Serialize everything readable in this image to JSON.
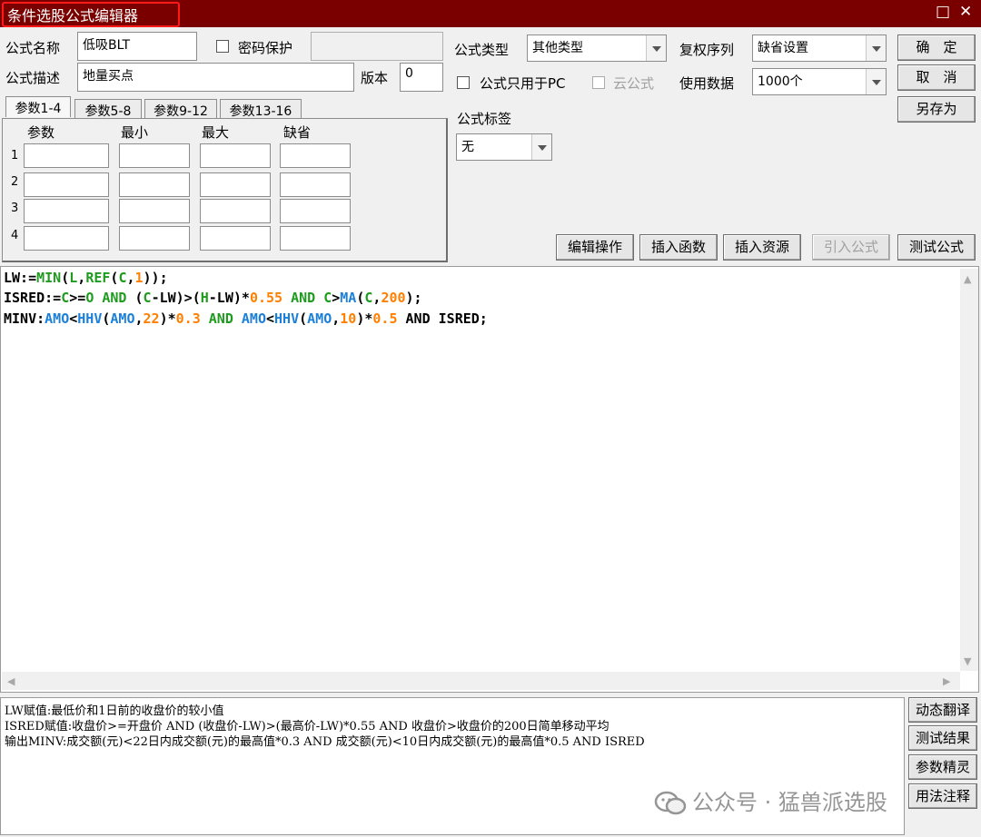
{
  "window": {
    "title": "条件选股公式编辑器",
    "maximize_icon": "□",
    "close_icon": "✕"
  },
  "form": {
    "name_label": "公式名称",
    "name_value": "低吸BLT",
    "password_label": "密码保护",
    "desc_label": "公式描述",
    "desc_value": "地量买点",
    "version_label": "版本",
    "version_value": "0",
    "type_label": "公式类型",
    "type_value": "其他类型",
    "restore_label": "复权序列",
    "restore_value": "缺省设置",
    "pc_only_label": "公式只用于PC",
    "cloud_label": "云公式",
    "data_label": "使用数据",
    "data_value": "1000个",
    "tag_label": "公式标签",
    "tag_value": "无"
  },
  "buttons": {
    "ok": "确　定",
    "cancel": "取　消",
    "save_as": "另存为",
    "edit_ops": "编辑操作",
    "insert_func": "插入函数",
    "insert_res": "插入资源",
    "import_formula": "引入公式",
    "test_formula": "测试公式",
    "dyn_translate": "动态翻译",
    "test_result": "测试结果",
    "param_wizard": "参数精灵",
    "usage_note": "用法注释"
  },
  "params": {
    "tabs": [
      "参数1-4",
      "参数5-8",
      "参数9-12",
      "参数13-16"
    ],
    "headers": [
      "参数",
      "最小",
      "最大",
      "缺省"
    ],
    "rows": [
      "1",
      "2",
      "3",
      "4"
    ]
  },
  "code": {
    "l1": [
      "LW:=",
      "MIN",
      "(",
      "L",
      ",",
      "REF",
      "(",
      "C",
      ",",
      "1",
      "));"
    ],
    "l2": [
      "ISRED:=",
      "C",
      ">=",
      "O",
      " AND ",
      "(",
      "C",
      "-LW)>(",
      "H",
      "-LW)*",
      "0.55",
      " AND ",
      "C",
      ">",
      "MA",
      "(",
      "C",
      ",",
      "200",
      ");"
    ],
    "l3": [
      "MINV:",
      "AMO",
      "<",
      "HHV",
      "(",
      "AMO",
      ",",
      "22",
      ")*",
      "0.3",
      " AND ",
      "AMO",
      "<",
      "HHV",
      "(",
      "AMO",
      ",",
      "10",
      ")*",
      "0.5",
      " AND ISRED;"
    ]
  },
  "notes": [
    "LW赋值:最低价和1日前的收盘价的较小值",
    "ISRED赋值:收盘价>=开盘价 AND (收盘价-LW)>(最高价-LW)*0.55 AND 收盘价>收盘价的200日简单移动平均",
    "输出MINV:成交额(元)<22日内成交额(元)的最高值*0.3 AND 成交额(元)<10日内成交额(元)的最高值*0.5 AND ISRED"
  ],
  "watermark": "公众号 · 猛兽派选股",
  "scroll_arrows": {
    "up": "▲",
    "down": "▼",
    "left": "◀",
    "right": "▶"
  }
}
